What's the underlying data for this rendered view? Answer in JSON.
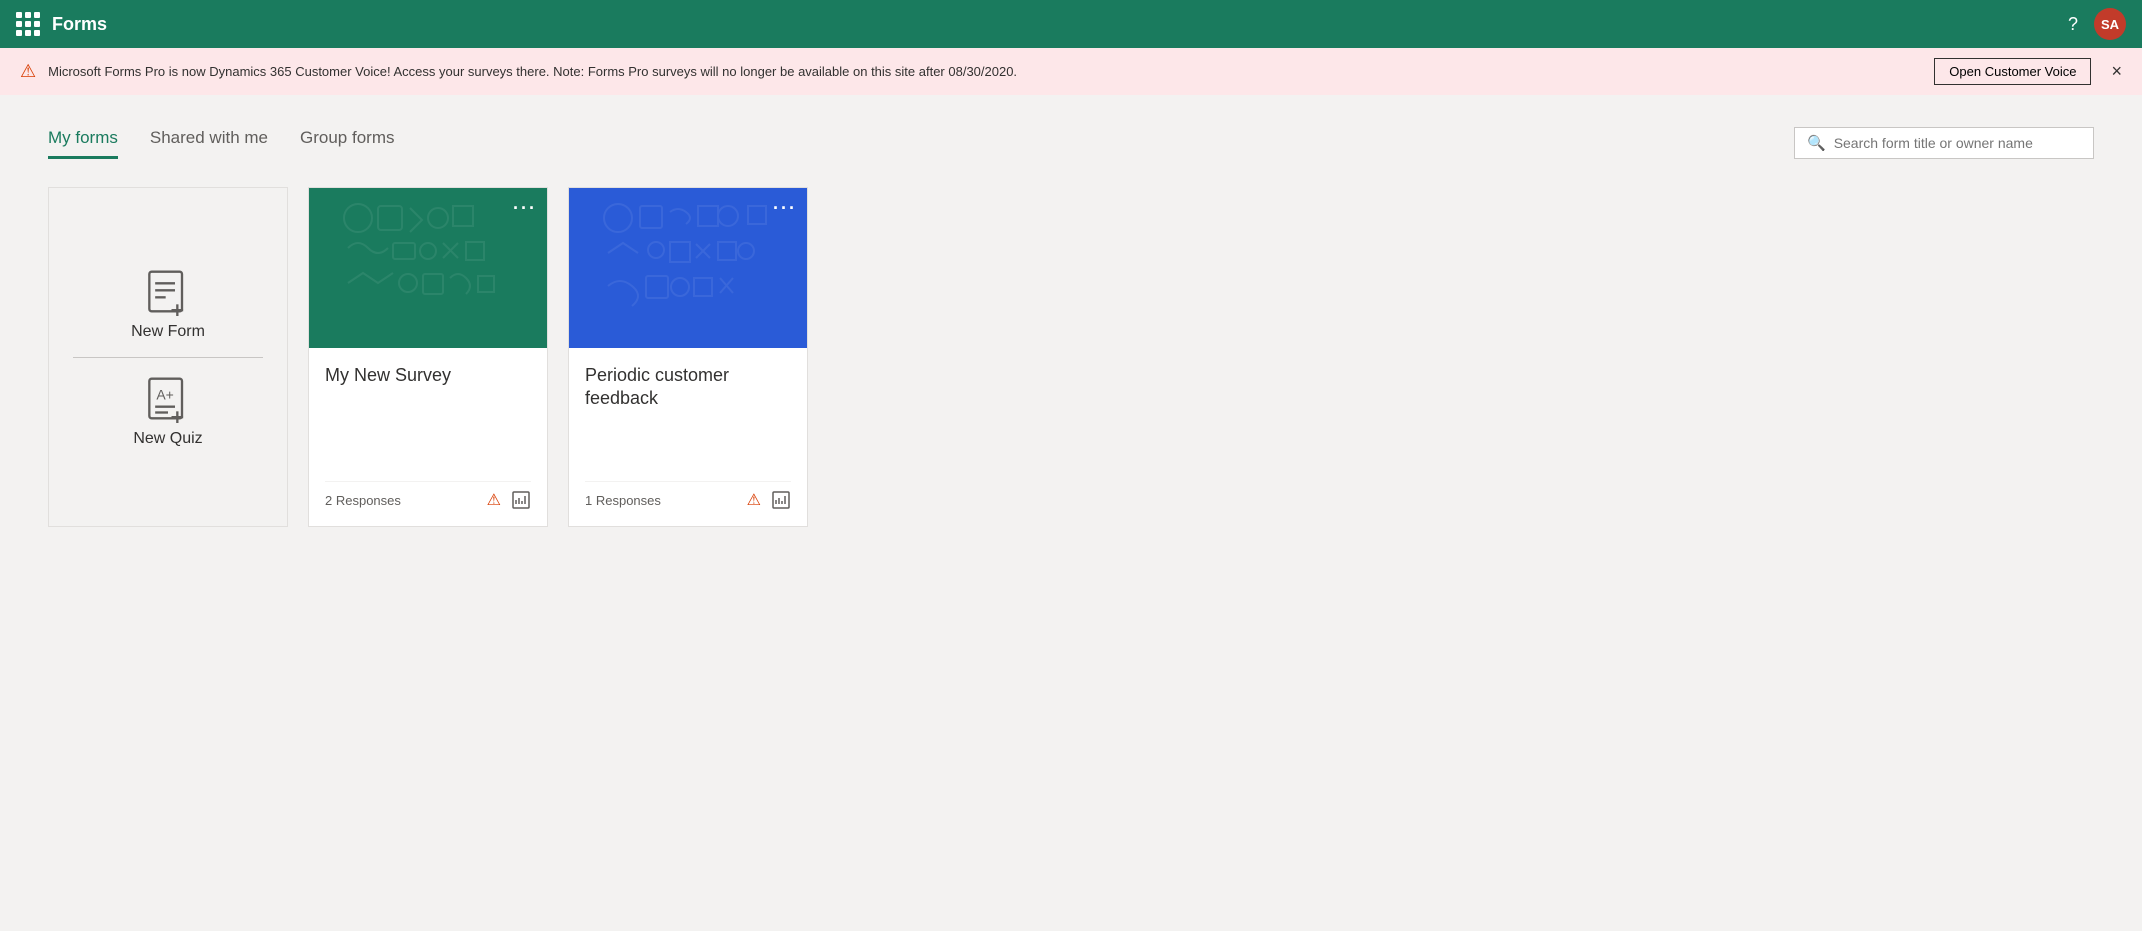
{
  "app": {
    "title": "Forms",
    "avatar_initials": "SA",
    "avatar_bg": "#c23b2a"
  },
  "banner": {
    "message": "Microsoft Forms Pro is now Dynamics 365 Customer Voice! Access your surveys there. Note: Forms Pro surveys will no longer be available on this site after 08/30/2020.",
    "button_label": "Open Customer Voice",
    "close_label": "×"
  },
  "tabs": [
    {
      "id": "my-forms",
      "label": "My forms",
      "active": true
    },
    {
      "id": "shared-with-me",
      "label": "Shared with me",
      "active": false
    },
    {
      "id": "group-forms",
      "label": "Group forms",
      "active": false
    }
  ],
  "search": {
    "placeholder": "Search form title or owner name"
  },
  "new_form_card": {
    "new_form_label": "New Form",
    "new_quiz_label": "New Quiz"
  },
  "form_cards": [
    {
      "id": "survey-1",
      "title": "My New Survey",
      "responses": "2 Responses",
      "header_color": "teal",
      "more_btn": "···"
    },
    {
      "id": "survey-2",
      "title": "Periodic customer feedback",
      "responses": "1 Responses",
      "header_color": "blue",
      "more_btn": "···"
    }
  ],
  "icons": {
    "waffle": "waffle-icon",
    "help": "?",
    "search": "🔍",
    "warning": "⚠",
    "close": "✕"
  }
}
